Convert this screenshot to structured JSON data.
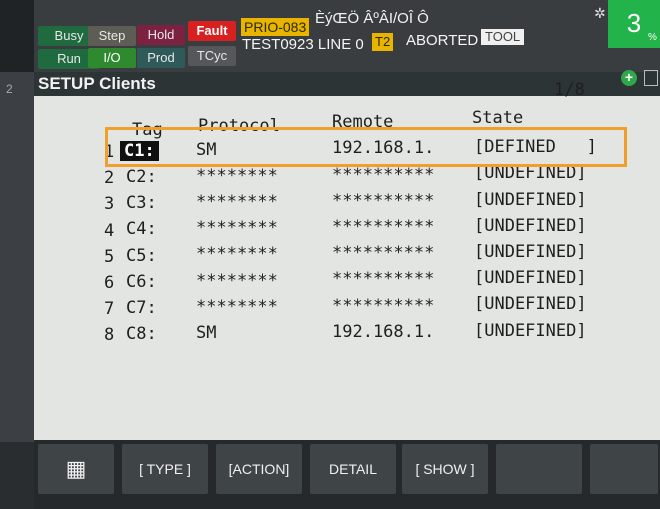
{
  "status": {
    "lamps": {
      "busy": "Busy",
      "step": "Step",
      "hold": "Hold",
      "fault": "Fault",
      "run": "Run",
      "io": "I/O",
      "prod": "Prod",
      "tcyc": "TCyc"
    },
    "prio": "PRIO-083",
    "garbled_text": "ÈýŒÖ ÂºÂI/OÎ  Ô",
    "program_line": "TEST0923 LINE 0",
    "t2": "T2",
    "aborted": "ABORTED",
    "tool": "TOOL",
    "override_value": "3",
    "override_unit": "%"
  },
  "title": "SETUP Clients",
  "page_indicator": "1/8",
  "columns": {
    "tag": "Tag",
    "protocol": "Protocol",
    "remote": "Remote",
    "state": "State"
  },
  "rows": [
    {
      "num": "1",
      "tag": "C1:",
      "protocol": "SM",
      "remote": "192.168.1.",
      "state": "[DEFINED   ]"
    },
    {
      "num": "2",
      "tag": "C2:",
      "protocol": "********",
      "remote": "**********",
      "state": "[UNDEFINED]"
    },
    {
      "num": "3",
      "tag": "C3:",
      "protocol": "********",
      "remote": "**********",
      "state": "[UNDEFINED]"
    },
    {
      "num": "4",
      "tag": "C4:",
      "protocol": "********",
      "remote": "**********",
      "state": "[UNDEFINED]"
    },
    {
      "num": "5",
      "tag": "C5:",
      "protocol": "********",
      "remote": "**********",
      "state": "[UNDEFINED]"
    },
    {
      "num": "6",
      "tag": "C6:",
      "protocol": "********",
      "remote": "**********",
      "state": "[UNDEFINED]"
    },
    {
      "num": "7",
      "tag": "C7:",
      "protocol": "********",
      "remote": "**********",
      "state": "[UNDEFINED]"
    },
    {
      "num": "8",
      "tag": "C8:",
      "protocol": "SM",
      "remote": "192.168.1.",
      "state": "[UNDEFINED]"
    }
  ],
  "fkeys": {
    "menu_icon": "grid-icon",
    "type": "[ TYPE ]",
    "action": "[ACTION]",
    "detail": "DETAIL",
    "show": "[ SHOW ]"
  },
  "colors": {
    "highlight": "#f0a02a",
    "override": "#22b34a",
    "fault": "#d82020"
  }
}
